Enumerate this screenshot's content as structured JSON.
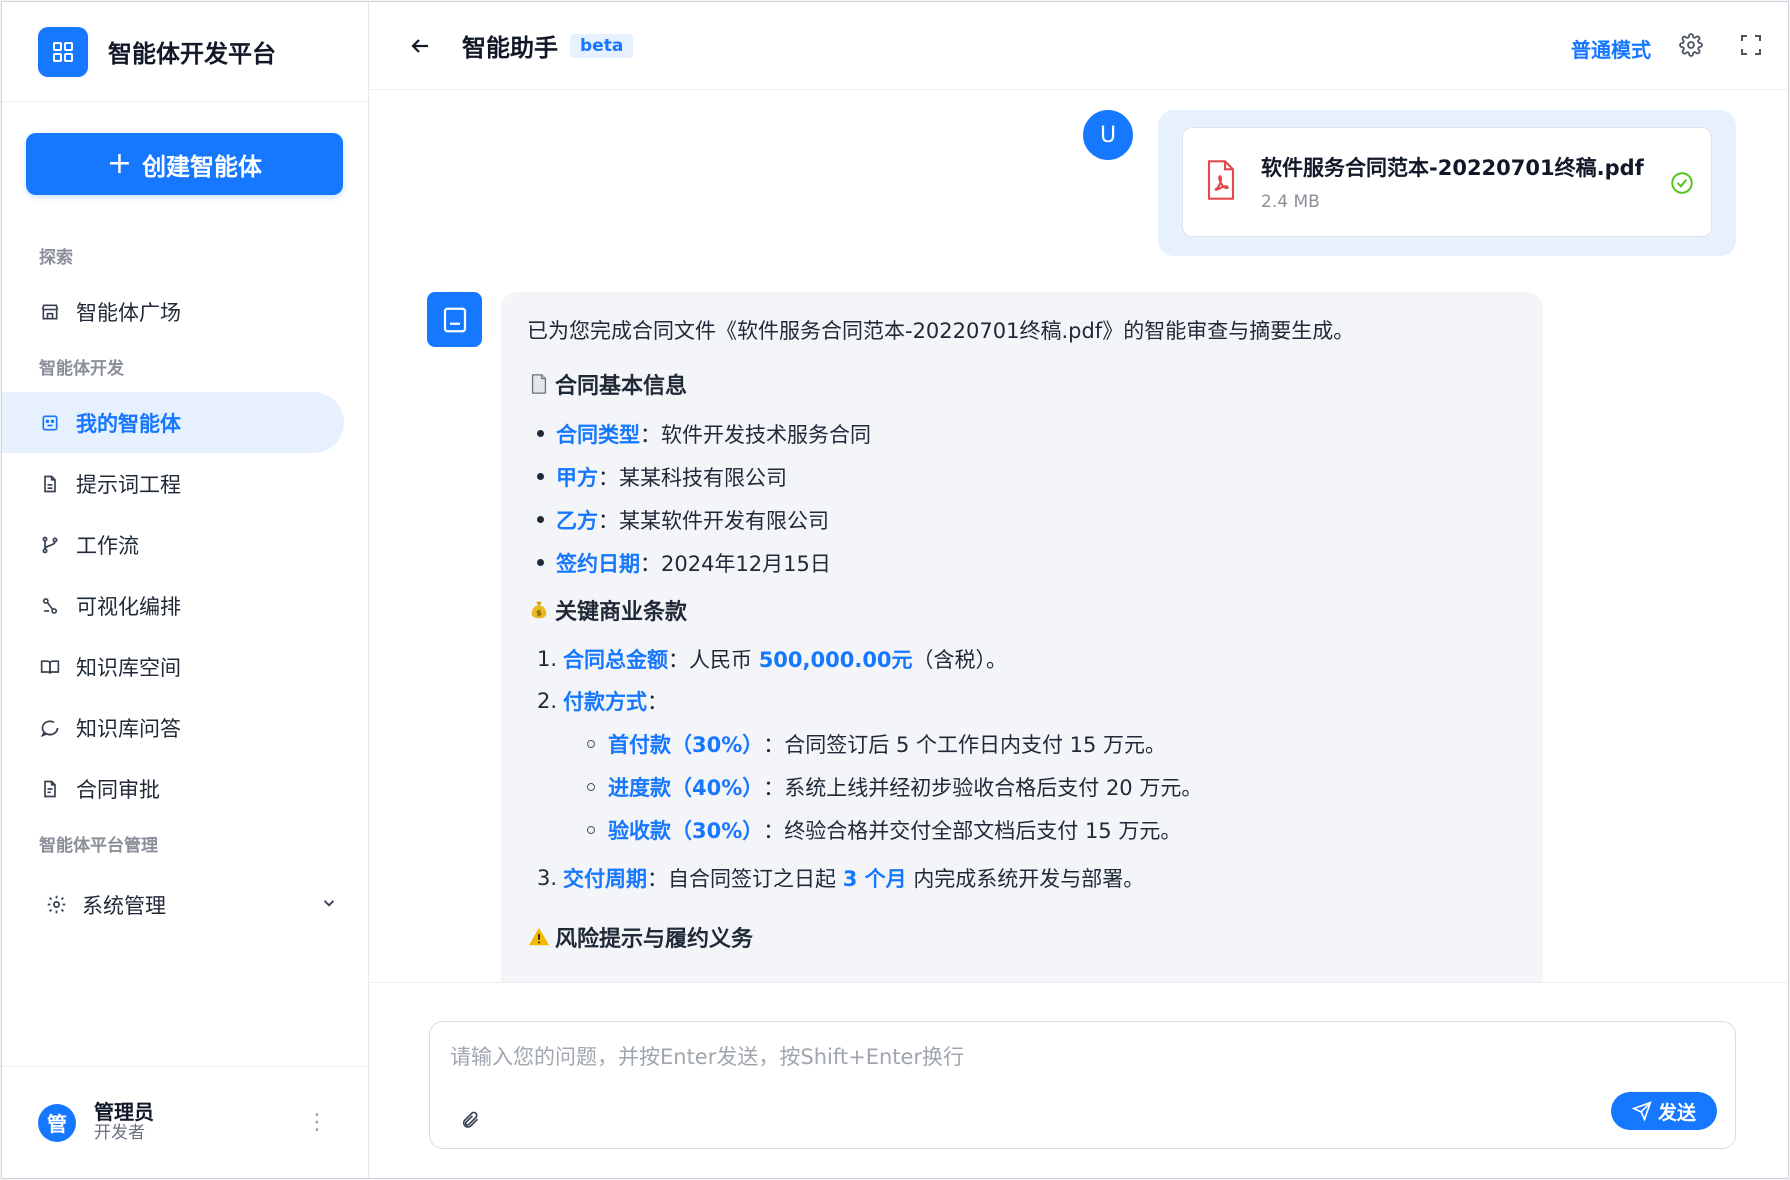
{
  "app": {
    "name": "智能体开发平台",
    "create_button": "创建智能体"
  },
  "sidebar": {
    "sections": [
      {
        "label": "探索"
      },
      {
        "label": "智能体开发"
      },
      {
        "label": "智能体平台管理"
      }
    ],
    "items": [
      {
        "label": "智能体广场",
        "icon": "store-icon"
      },
      {
        "label": "我的智能体",
        "icon": "bot-icon",
        "active": true
      },
      {
        "label": "提示词工程",
        "icon": "document-icon"
      },
      {
        "label": "工作流",
        "icon": "branch-icon"
      },
      {
        "label": "可视化编排",
        "icon": "flow-icon"
      },
      {
        "label": "知识库空间",
        "icon": "book-icon"
      },
      {
        "label": "知识库问答",
        "icon": "chat-icon"
      },
      {
        "label": "合同审批",
        "icon": "file-icon"
      },
      {
        "label": "系统管理",
        "icon": "gear-icon"
      }
    ],
    "user": {
      "avatar": "管",
      "name": "管理员",
      "role": "开发者"
    }
  },
  "header": {
    "title": "智能助手",
    "badge": "beta",
    "mode": "普通模式"
  },
  "chat": {
    "user_avatar": "U",
    "file": {
      "name": "软件服务合同范本-20220701终稿.pdf",
      "size": "2.4 MB"
    },
    "reply": {
      "intro": "已为您完成合同文件《软件服务合同范本-20220701终稿.pdf》的智能审查与摘要生成。",
      "section1_title": "合同基本信息",
      "basic_info": [
        {
          "key": "合同类型",
          "value": "软件开发技术服务合同"
        },
        {
          "key": "甲方",
          "value": "某某科技有限公司"
        },
        {
          "key": "乙方",
          "value": "某某软件开发有限公司"
        },
        {
          "key": "签约日期",
          "value": "2024年12月15日"
        }
      ],
      "section2_title": "关键商业条款",
      "terms": {
        "t1_num": "1.",
        "t1_key": "合同总金额",
        "t1_pre": "人民币",
        "t1_amount": "500,000.00元",
        "t1_post": "（含税）。",
        "t2_num": "2.",
        "t2_key": "付款方式",
        "payments": [
          {
            "key": "首付款（30%）",
            "value": "合同签订后 5 个工作日内支付 15 万元。"
          },
          {
            "key": "进度款（40%）",
            "value": "系统上线并经初步验收合格后支付 20 万元。"
          },
          {
            "key": "验收款（30%）",
            "value": "终验合格并交付全部文档后支付 15 万元。"
          }
        ],
        "t3_num": "3.",
        "t3_key": "交付周期",
        "t3_pre": "自合同签订之日起",
        "t3_period": "3 个月",
        "t3_post": "内完成系统开发与部署。"
      },
      "section3_title": "风险提示与履约义务"
    }
  },
  "composer": {
    "placeholder": "请输入您的问题，并按Enter发送，按Shift+Enter换行",
    "send_label": "发送"
  },
  "colors": {
    "accent": "#1677ff",
    "accent_light": "#e6f0ff",
    "user_bubble": "#e6f1fd",
    "bot_bubble": "#f3f5f8",
    "pdf_red": "#e5484d",
    "success_green": "#52c41a"
  }
}
